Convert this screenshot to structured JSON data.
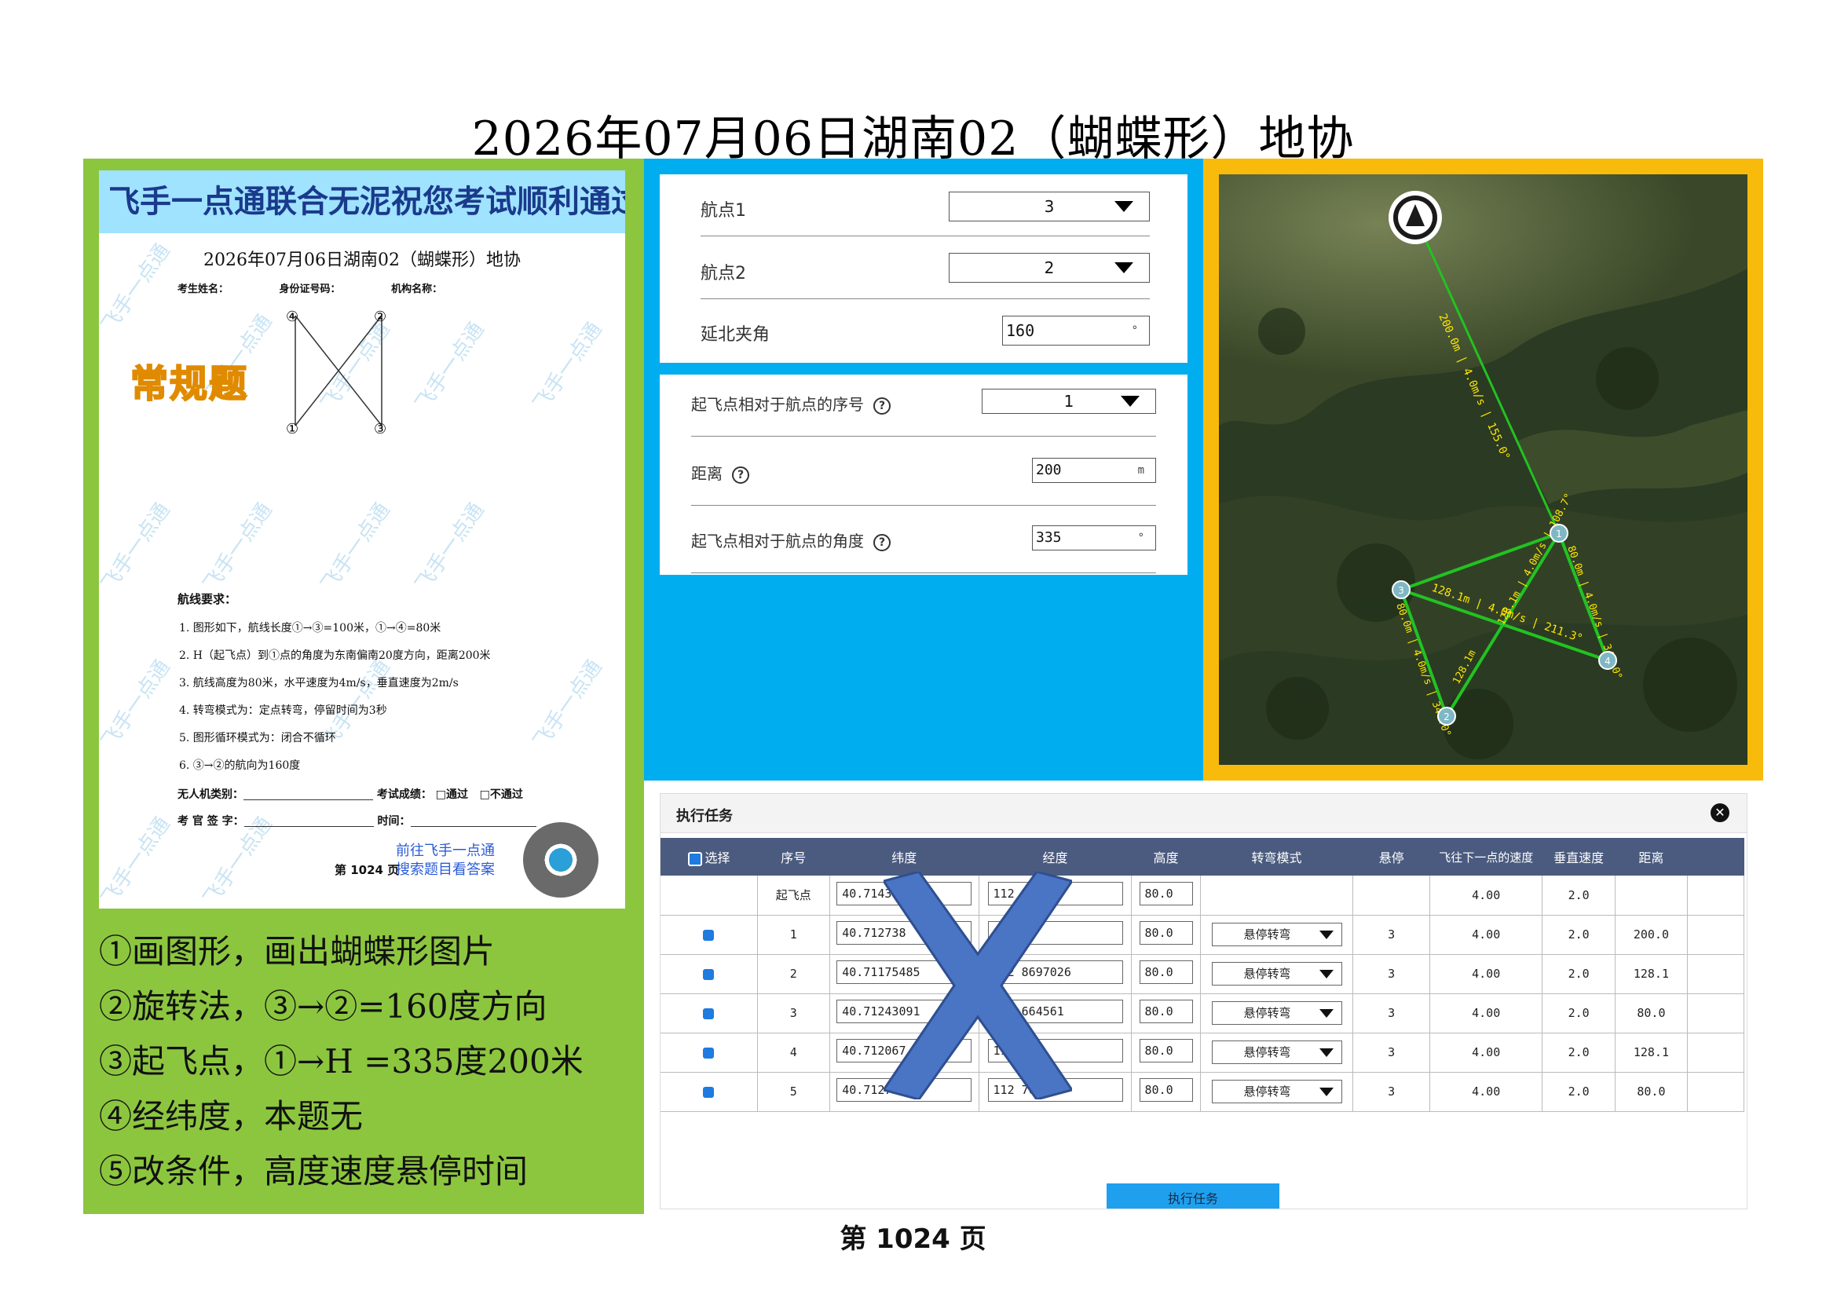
{
  "page_title": "2026年07月06日湖南02（蝴蝶形）地协",
  "paper": {
    "banner": "飞手一点通联合无泥祝您考试顺利通过",
    "watermark": "飞手一点通",
    "doc_title": "2026年07月06日湖南02（蝴蝶形）地协",
    "fields": [
      "考生姓名：",
      "身份证号码：",
      "机构名称："
    ],
    "diagram_labels": [
      "④",
      "②",
      "①",
      "③"
    ],
    "badge": "常规题",
    "req_head": "航线要求：",
    "requirements": [
      "1. 图形如下，航线长度①→③=100米，①→④=80米",
      "2. H（起飞点）到①点的角度为东南偏南20度方向，距离200米",
      "3. 航线高度为80米，水平速度为4m/s，垂直速度为2m/s",
      "4. 转弯模式为：定点转弯，停留时间为3秒",
      "5. 图形循环模式为：闭合不循环",
      "6. ③→②的航向为160度"
    ],
    "uav_label": "无人机类别：",
    "result_label": "考试成绩：",
    "pass_label": "□通过",
    "fail_label": "□不通过",
    "examiner_label": "考 官 签 字：",
    "time_label": "时间：",
    "goto_1": "前往飞手一点通",
    "goto_2": "搜索题目看答案",
    "page": "第 1024 页"
  },
  "notes": [
    "①画图形，画出蝴蝶形图片",
    "②旋转法，③→②=160度方向",
    "③起飞点，①→H =335度200米",
    "④经纬度，本题无",
    "⑤改条件，高度速度悬停时间"
  ],
  "form1": {
    "wp1_label": "航点1",
    "wp1_value": "3",
    "wp2_label": "航点2",
    "wp2_value": "2",
    "angle_label": "延北夹角",
    "angle_value": "160",
    "angle_unit": "°"
  },
  "form2": {
    "seq_label": "起飞点相对于航点的序号",
    "seq_value": "1",
    "dist_label": "距离",
    "dist_value": "200",
    "dist_unit": "m",
    "ang_label": "起飞点相对于航点的角度",
    "ang_value": "335",
    "ang_unit": "°",
    "help": "?"
  },
  "map": {
    "seg_home": "200.0m | 4.0m/s | 155.0°",
    "seg_1_3": "128.1m | 4.0m/s | 211.3°",
    "seg_1_4": "80.0m | 4.0m/s | 340.0°",
    "seg_3_2": "80.0m | 4.0m/s | 340.0°",
    "seg_4_3": "128.1m | 4.0m/s | 108.7°",
    "seg_2_4": "128.1m",
    "nums": [
      "1",
      "2",
      "3",
      "4"
    ]
  },
  "task": {
    "title": "执行任务",
    "close": "✕",
    "columns": [
      "选择",
      "序号",
      "纬度",
      "经度",
      "高度",
      "转弯模式",
      "悬停",
      "飞往下一点的速度",
      "垂直速度",
      "距离"
    ],
    "rows": [
      {
        "seq": "起飞点",
        "lat": "40.71436",
        "lon": "112 5766",
        "alt": "80.0",
        "mode": "",
        "hover": "",
        "speed": "4.00",
        "vspeed": "2.0",
        "dist": ""
      },
      {
        "seq": "1",
        "lat": "40.712738",
        "lon": "11 052",
        "alt": "80.0",
        "mode": "悬停转弯",
        "hover": "3",
        "speed": "4.00",
        "vspeed": "2.0",
        "dist": "200.0"
      },
      {
        "seq": "2",
        "lat": "40.71175485",
        "lon": "112 8697026",
        "alt": "80.0",
        "mode": "悬停转弯",
        "hover": "3",
        "speed": "4.00",
        "vspeed": "2.0",
        "dist": "128.1"
      },
      {
        "seq": "3",
        "lat": "40.71243091",
        "lon": "112 664561",
        "alt": "80.0",
        "mode": "悬停转弯",
        "hover": "3",
        "speed": "4.00",
        "vspeed": "2.0",
        "dist": "80.0"
      },
      {
        "seq": "4",
        "lat": "40.712067",
        "lon": "11 514",
        "alt": "80.0",
        "mode": "悬停转弯",
        "hover": "3",
        "speed": "4.00",
        "vspeed": "2.0",
        "dist": "128.1"
      },
      {
        "seq": "5",
        "lat": "40.71273850",
        "lon": "112 76052",
        "alt": "80.0",
        "mode": "悬停转弯",
        "hover": "3",
        "speed": "4.00",
        "vspeed": "2.0",
        "dist": "80.0"
      }
    ],
    "exec_button": "执行任务"
  },
  "footer": "第 1024 页",
  "colors": {
    "green": "#8cc63f",
    "blue": "#00adef",
    "yellow": "#f8bb0c",
    "header": "#4b5b7f",
    "cross": "#4a74c4"
  }
}
